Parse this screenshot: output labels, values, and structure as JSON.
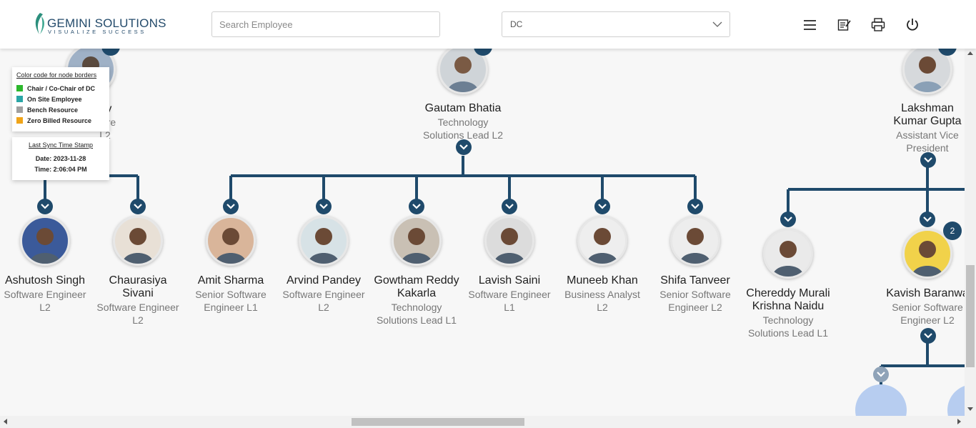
{
  "header": {
    "logo_name": "GEMINI SOLUTIONS",
    "logo_tagline": "VISUALIZE SUCCESS",
    "search_placeholder": "Search Employee",
    "dc_select_value": "DC",
    "icons": [
      "menu-icon",
      "notes-icon",
      "printer-icon",
      "power-icon"
    ]
  },
  "legend": {
    "title": "Color code for node borders",
    "items": [
      {
        "label": "Chair / Co-Chair of DC",
        "color": "#2db82d"
      },
      {
        "label": "On Site Employee",
        "color": "#2aa6a6"
      },
      {
        "label": "Bench Resource",
        "color": "#a0a0a0"
      },
      {
        "label": "Zero Billed Resource",
        "color": "#f0a418"
      }
    ]
  },
  "sync": {
    "title": "Last Sync Time Stamp",
    "date": "Date: 2023-11-28",
    "time": "Time: 2:06:04 PM"
  },
  "top_nodes": [
    {
      "name": "nney",
      "desc": [
        "ware",
        "L2"
      ]
    },
    {
      "name": "Gautam Bhatia",
      "desc": [
        "Technology",
        "Solutions Lead L2"
      ]
    },
    {
      "name": [
        "Lakshman",
        "Kumar Gupta"
      ],
      "desc": [
        "Assistant Vice",
        "President"
      ]
    }
  ],
  "children": [
    {
      "name": [
        "Ashutosh Singh"
      ],
      "desc": [
        "Software Engineer",
        "L2"
      ]
    },
    {
      "name": [
        "Chaurasiya",
        "Sivani"
      ],
      "desc": [
        "Software Engineer",
        "L2"
      ]
    },
    {
      "name": [
        "Amit Sharma"
      ],
      "desc": [
        "Senior Software",
        "Engineer L1"
      ]
    },
    {
      "name": [
        "Arvind Pandey"
      ],
      "desc": [
        "Software Engineer",
        "L2"
      ]
    },
    {
      "name": [
        "Gowtham Reddy",
        "Kakarla"
      ],
      "desc": [
        "Technology",
        "Solutions Lead L1"
      ]
    },
    {
      "name": [
        "Lavish Saini"
      ],
      "desc": [
        "Software Engineer",
        "L1"
      ]
    },
    {
      "name": [
        "Muneeb Khan"
      ],
      "desc": [
        "Business Analyst",
        "L2"
      ]
    },
    {
      "name": [
        "Shifa Tanveer"
      ],
      "desc": [
        "Senior Software",
        "Engineer L2"
      ]
    },
    {
      "name": [
        "Chereddy Murali",
        "Krishna Naidu"
      ],
      "desc": [
        "Technology",
        "Solutions Lead L1"
      ]
    },
    {
      "name": [
        "Kavish Baranwa"
      ],
      "desc": [
        "Senior Software",
        "Engineer L2"
      ],
      "badge": "2"
    }
  ],
  "colors": {
    "accent": "#1f4a6b",
    "line": "#1f4a6b",
    "avatar_light": "#b7cdf0"
  }
}
